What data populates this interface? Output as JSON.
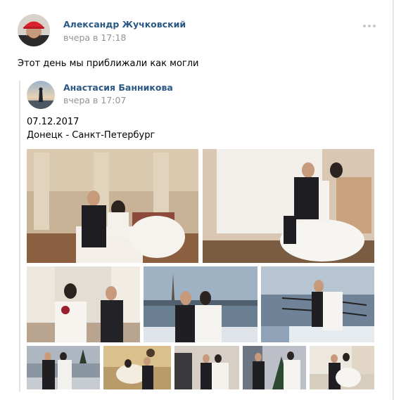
{
  "post": {
    "author_name": "Александр Жучковский",
    "time": "вчера в 17:18",
    "text": "Этот день мы приближали как могли",
    "more_icon": "more-horizontal-icon"
  },
  "repost": {
    "author_name": "Анастасия Банникова",
    "time": "вчера в 17:07",
    "date_line": "07.12.2017",
    "route_line": "Донецк - Санкт-Петербург",
    "photos_count": 10
  },
  "colors": {
    "link": "#2a5885",
    "muted": "#939393",
    "background": "#edeef0",
    "divider": "#dfe3e9"
  }
}
